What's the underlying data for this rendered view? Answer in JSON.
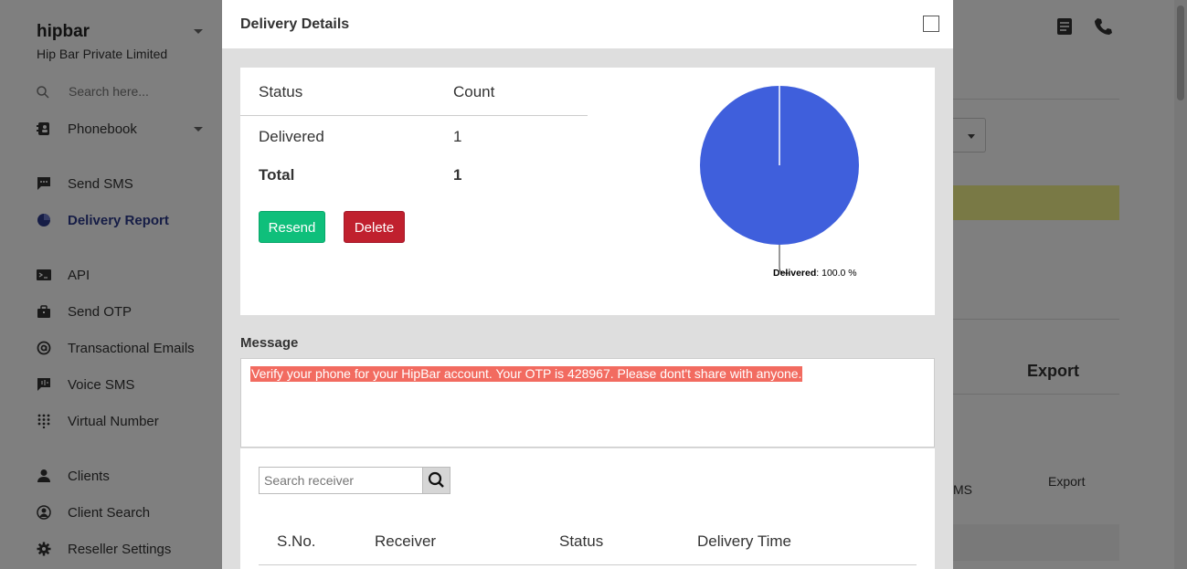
{
  "sidebar": {
    "brand": "hipbar",
    "company": "Hip Bar Private Limited",
    "search_placeholder": "Search here...",
    "items": [
      {
        "label": "Phonebook",
        "icon": "phonebook-icon"
      },
      {
        "label": "Send SMS",
        "icon": "chat-icon"
      },
      {
        "label": "Delivery Report",
        "icon": "pie-chart-icon",
        "active": true
      },
      {
        "label": "API",
        "icon": "terminal-icon"
      },
      {
        "label": "Send OTP",
        "icon": "briefcase-icon"
      },
      {
        "label": "Transactional Emails",
        "icon": "at-icon"
      },
      {
        "label": "Voice SMS",
        "icon": "voice-chat-icon"
      },
      {
        "label": "Virtual Number",
        "icon": "dialpad-icon"
      },
      {
        "label": "Clients",
        "icon": "user-icon"
      },
      {
        "label": "Client Search",
        "icon": "user-search-icon"
      },
      {
        "label": "Reseller Settings",
        "icon": "gear-icon"
      }
    ]
  },
  "background": {
    "export_header": "Export",
    "sms_fragment": "MS",
    "export_link": "Export",
    "banner_color": "#f3f28a"
  },
  "modal": {
    "title": "Delivery Details",
    "summary": {
      "headers": {
        "status": "Status",
        "count": "Count"
      },
      "rows": [
        {
          "status": "Delivered",
          "count": "1"
        }
      ],
      "total": {
        "label": "Total",
        "count": "1"
      }
    },
    "buttons": {
      "resend": "Resend",
      "delete": "Delete"
    },
    "chart_data": {
      "type": "pie",
      "slices": [
        {
          "label": "Delivered",
          "value": 100.0,
          "color": "#3f5fdc"
        }
      ],
      "data_label": {
        "name": "Delivered",
        "value_text": ": 100.0 %"
      }
    },
    "message": {
      "label": "Message",
      "text": "Verify your phone for your HipBar account. Your OTP is 428967. Please dont't share with anyone.",
      "highlight_color": "#f26b60"
    },
    "receivers": {
      "search_placeholder": "Search receiver",
      "columns": [
        "S.No.",
        "Receiver",
        "Status",
        "Delivery Time"
      ]
    }
  },
  "colors": {
    "resend": "#0fbf7b",
    "delete": "#c0202e",
    "active_nav": "#2d3a8c"
  }
}
